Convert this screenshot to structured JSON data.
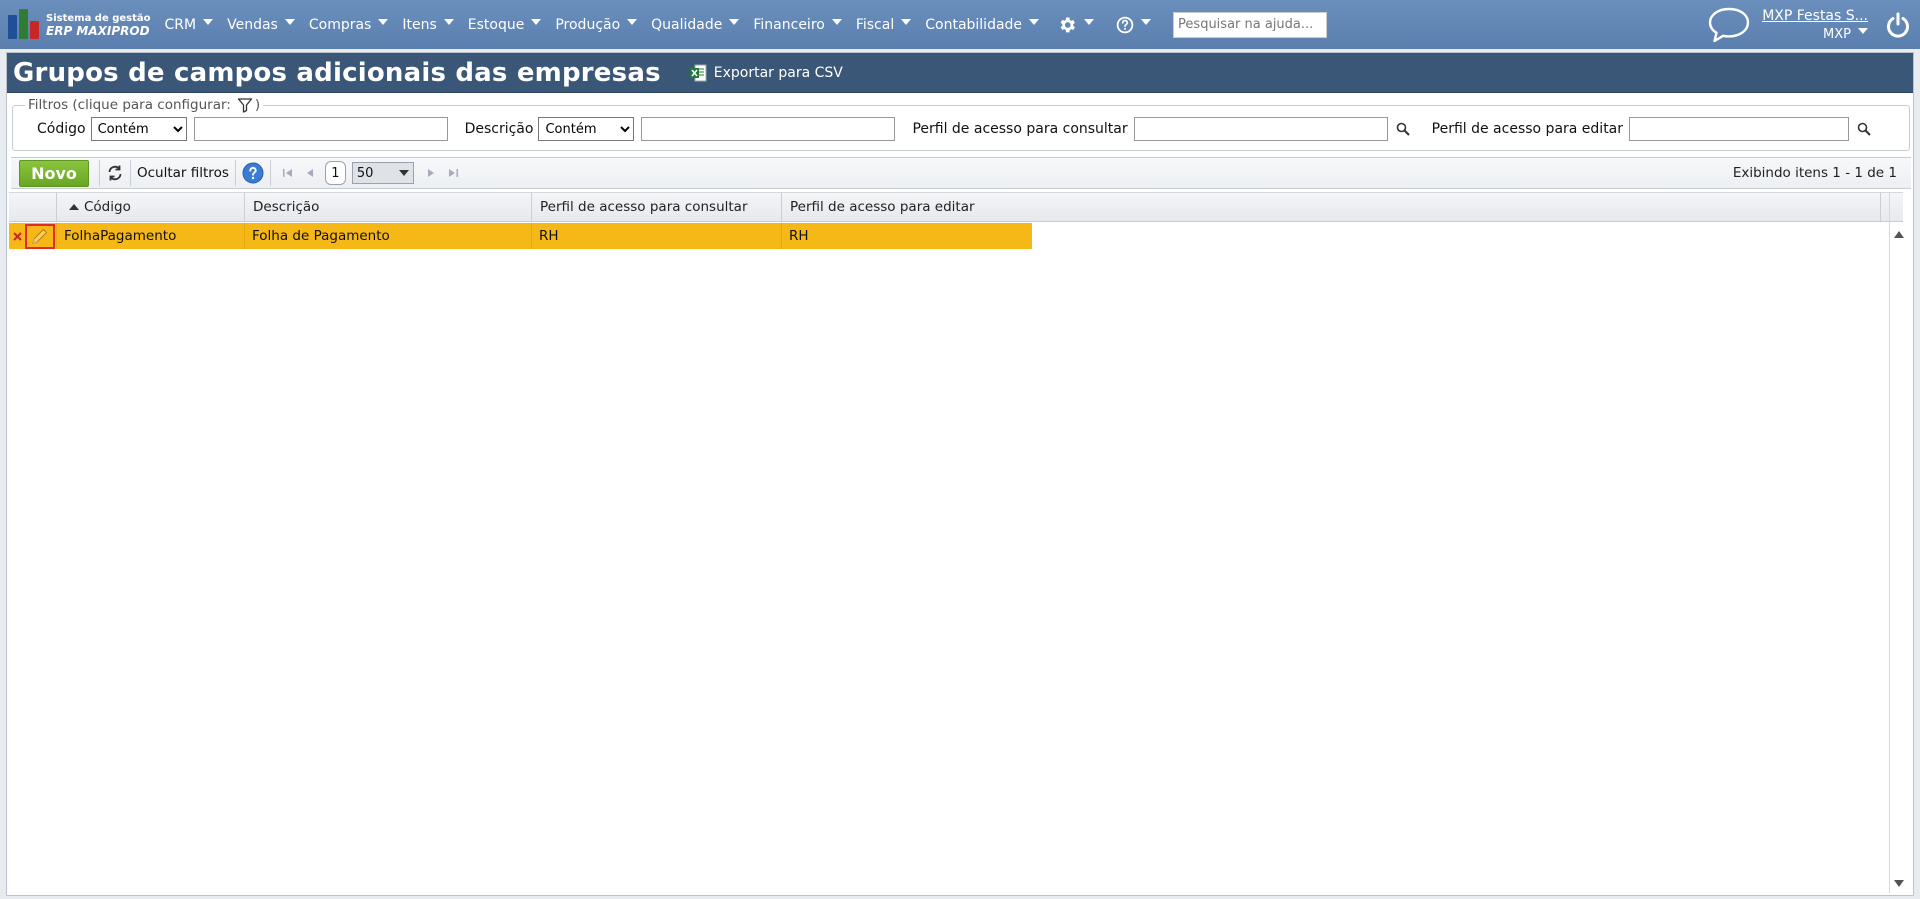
{
  "app": {
    "logo_line1": "Sistema de gestão",
    "logo_line2": "ERP MAXIPROD"
  },
  "menu": [
    {
      "label": "CRM"
    },
    {
      "label": "Vendas"
    },
    {
      "label": "Compras"
    },
    {
      "label": "Itens"
    },
    {
      "label": "Estoque"
    },
    {
      "label": "Produção"
    },
    {
      "label": "Qualidade"
    },
    {
      "label": "Financeiro"
    },
    {
      "label": "Fiscal"
    },
    {
      "label": "Contabilidade"
    }
  ],
  "help_search": {
    "placeholder": "Pesquisar na ajuda..."
  },
  "user": {
    "name": "MXP Festas S...",
    "company": "MXP"
  },
  "page": {
    "title": "Grupos de campos adicionais das empresas",
    "export_label": "Exportar para CSV"
  },
  "filters": {
    "legend": "Filtros (clique para configurar:",
    "legend_close": ")",
    "codigo_label": "Código",
    "codigo_mode": "Contém",
    "descricao_label": "Descrição",
    "descricao_mode": "Contém",
    "consultar_label": "Perfil de acesso para consultar",
    "editar_label": "Perfil de acesso para editar",
    "codigo_value": "",
    "descricao_value": "",
    "consultar_value": "",
    "editar_value": ""
  },
  "toolbar": {
    "new_label": "Novo",
    "hide_filters_label": "Ocultar filtros",
    "page": "1",
    "page_size": "50",
    "pager_info": "Exibindo itens 1 - 1 de 1"
  },
  "grid": {
    "columns": [
      "Código",
      "Descrição",
      "Perfil de acesso para consultar",
      "Perfil de acesso para editar"
    ],
    "rows": [
      {
        "codigo": "FolhaPagamento",
        "descricao": "Folha de Pagamento",
        "consultar": "RH",
        "editar": "RH"
      }
    ]
  },
  "colors": {
    "topbar": "#5a7fae",
    "title_bar": "#3b5778",
    "selected_row": "#f6b817",
    "new_button": "#7ab532",
    "edit_highlight": "#e02b2b"
  }
}
